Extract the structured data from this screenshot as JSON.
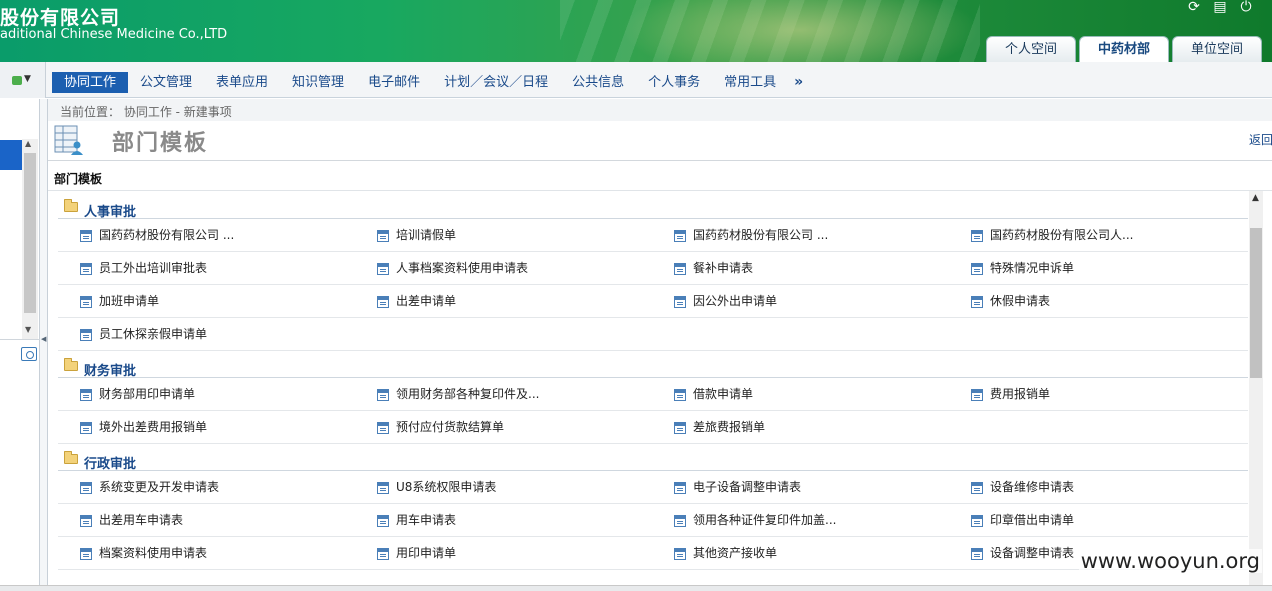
{
  "header": {
    "company_cn": "股份有限公司",
    "company_en": "aditional Chinese Medicine Co.,LTD",
    "icons": [
      "refresh-icon",
      "export-icon",
      "logout-icon"
    ],
    "space_tabs": [
      {
        "label": "个人空间",
        "active": false
      },
      {
        "label": "中药材部",
        "active": true
      },
      {
        "label": "单位空间",
        "active": false
      }
    ]
  },
  "nav": {
    "items": [
      "协同工作",
      "公文管理",
      "表单应用",
      "知识管理",
      "电子邮件",
      "计划／会议／日程",
      "公共信息",
      "个人事务",
      "常用工具"
    ],
    "active_index": 0,
    "more": "»"
  },
  "breadcrumb": "当前位置：  协同工作 - 新建事项",
  "page": {
    "title": "部门模板",
    "back": "返回",
    "section": "部门模板"
  },
  "categories": [
    {
      "name": "人事审批",
      "rows": [
        [
          "国药药材股份有限公司 ...",
          "培训请假单",
          "国药药材股份有限公司 ...",
          "国药药材股份有限公司人..."
        ],
        [
          "员工外出培训审批表",
          "人事档案资料使用申请表",
          "餐补申请表",
          "特殊情况申诉单"
        ],
        [
          "加班申请单",
          "出差申请单",
          "因公外出申请单",
          "休假申请表"
        ],
        [
          "员工休探亲假申请单"
        ]
      ]
    },
    {
      "name": "财务审批",
      "rows": [
        [
          "财务部用印申请单",
          "领用财务部各种复印件及...",
          "借款申请单",
          "费用报销单"
        ],
        [
          "境外出差费用报销单",
          "预付应付货款结算单",
          "差旅费报销单"
        ]
      ]
    },
    {
      "name": "行政审批",
      "rows": [
        [
          "系统变更及开发申请表",
          "U8系统权限申请表",
          "电子设备调整申请表",
          "设备维修申请表"
        ],
        [
          "出差用车申请表",
          "用车申请表",
          "领用各种证件复印件加盖...",
          "印章借出申请单"
        ],
        [
          "档案资料使用申请表",
          "用印申请单",
          "其他资产接收单",
          "设备调整申请表"
        ]
      ]
    }
  ],
  "watermark": "www.wooyun.org"
}
